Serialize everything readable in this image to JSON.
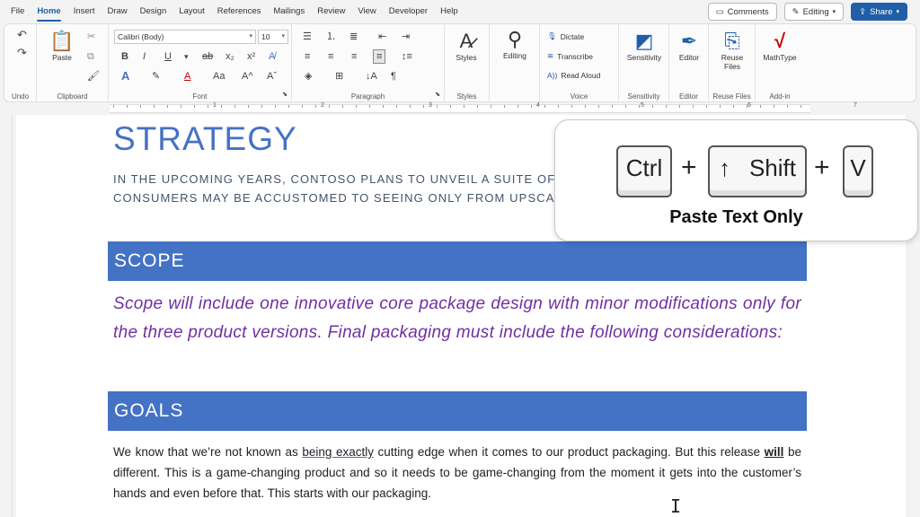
{
  "menu": {
    "tabs": [
      "File",
      "Home",
      "Insert",
      "Draw",
      "Design",
      "Layout",
      "References",
      "Mailings",
      "Review",
      "View",
      "Developer",
      "Help"
    ],
    "active_tab": "Home",
    "comments_label": "Comments",
    "editing_label": "Editing",
    "share_label": "Share"
  },
  "ribbon": {
    "undo_label": "Undo",
    "clipboard_label": "Clipboard",
    "paste_label": "Paste",
    "font_label": "Font",
    "font_name": "Calibri (Body)",
    "font_size": "10",
    "paragraph_label": "Paragraph",
    "styles_label": "Styles",
    "styles_button": "Styles",
    "editing_button": "Editing",
    "dictate_label": "Dictate",
    "transcribe_label": "Transcribe",
    "read_aloud_label": "Read Aloud",
    "voice_label": "Voice",
    "sensitivity_button": "Sensitivity",
    "sensitivity_label": "Sensitivity",
    "editor_button": "Editor",
    "editor_label": "Editor",
    "reuse_button_line1": "Reuse",
    "reuse_button_line2": "Files",
    "reuse_label": "Reuse Files",
    "mathtype_button": "MathType",
    "addin_label": "Add-in"
  },
  "ruler": {
    "numbers": [
      "1",
      "2",
      "3",
      "4",
      "5",
      "6",
      "7"
    ]
  },
  "document": {
    "title": "STRATEGY",
    "subtitle_line1": "IN THE UPCOMING YEARS, CONTOSO PLANS TO UNVEIL A SUITE OF HIGH",
    "subtitle_line2": "CONSUMERS MAY BE ACCUSTOMED TO SEEING ONLY FROM UPSCALE EL",
    "scope_heading": "SCOPE",
    "scope_text": "Scope will include one innovative core package design with minor modifications only for the three product versions. Final packaging must include the following considerations:",
    "goals_heading": "GOALS",
    "goals_part1": "We know that we’re not known as ",
    "goals_underlined": "being exactly",
    "goals_part2": " cutting edge when it comes to our product packaging. But this release ",
    "goals_bold": "will",
    "goals_part3": " be different. This is a game-changing product and so it needs to be game-changing from the moment it gets into the customer’s hands and even before that. This starts with our packaging."
  },
  "shortcut": {
    "key1": "Ctrl",
    "key2_arrow": "↑",
    "key2": "Shift",
    "key3": "V",
    "plus": "+",
    "caption": "Paste Text Only"
  },
  "colors": {
    "accent": "#1f5fa8",
    "heading_bar": "#4472c4",
    "scope_text": "#7030a0"
  }
}
